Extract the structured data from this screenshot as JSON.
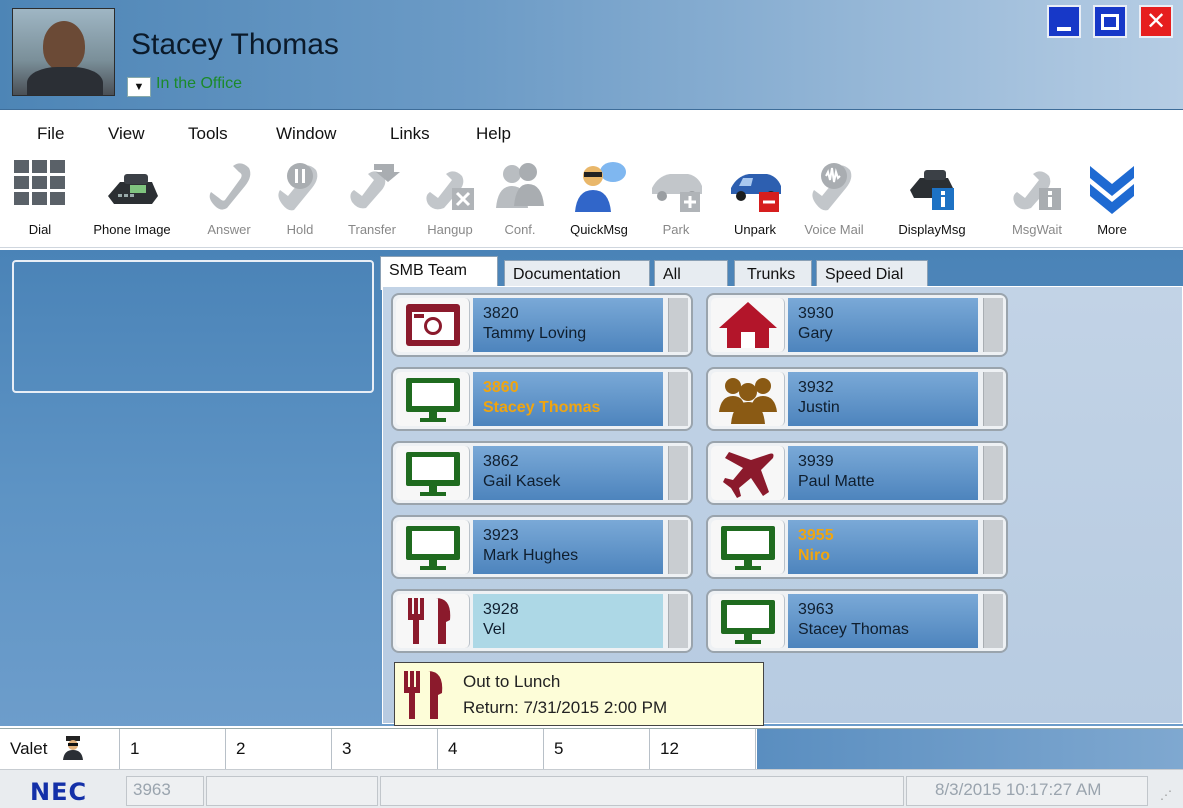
{
  "window": {
    "user_name": "Stacey Thomas",
    "presence": "In the Office",
    "controls": {
      "minimize": "minimize",
      "maximize": "maximize",
      "close": "✕"
    }
  },
  "menu": [
    "File",
    "View",
    "Tools",
    "Window",
    "Links",
    "Help"
  ],
  "toolbar": [
    {
      "label": "Dial",
      "icon": "dialpad-icon",
      "enabled": true
    },
    {
      "label": "Phone Image",
      "icon": "desk-phone-icon",
      "enabled": true
    },
    {
      "label": "Answer",
      "icon": "handset-icon",
      "enabled": false
    },
    {
      "label": "Hold",
      "icon": "hold-icon",
      "enabled": false
    },
    {
      "label": "Transfer",
      "icon": "transfer-icon",
      "enabled": false
    },
    {
      "label": "Hangup",
      "icon": "hangup-icon",
      "enabled": false
    },
    {
      "label": "Conf.",
      "icon": "conference-icon",
      "enabled": false
    },
    {
      "label": "QuickMsg",
      "icon": "quickmsg-icon",
      "enabled": true
    },
    {
      "label": "Park",
      "icon": "park-icon",
      "enabled": false
    },
    {
      "label": "Unpark",
      "icon": "unpark-icon",
      "enabled": true
    },
    {
      "label": "Voice Mail",
      "icon": "voicemail-icon",
      "enabled": false
    },
    {
      "label": "DisplayMsg",
      "icon": "displaymsg-icon",
      "enabled": true
    },
    {
      "label": "MsgWait",
      "icon": "msgwait-icon",
      "enabled": false
    },
    {
      "label": "More",
      "icon": "more-chevron-icon",
      "enabled": true
    }
  ],
  "tabs": [
    "SMB Team",
    "Documentation",
    "All",
    "Trunks",
    "Speed Dial"
  ],
  "active_tab": "SMB Team",
  "contacts": [
    {
      "ext": "3820",
      "name": "Tammy Loving",
      "status_icon": "camera-icon",
      "busy": false,
      "highlight": false
    },
    {
      "ext": "3930",
      "name": "Gary",
      "status_icon": "home-icon",
      "busy": false,
      "highlight": false
    },
    {
      "ext": "3860",
      "name": "Stacey Thomas",
      "status_icon": "monitor-icon",
      "busy": true,
      "highlight": false
    },
    {
      "ext": "3932",
      "name": "Justin",
      "status_icon": "meeting-icon",
      "busy": false,
      "highlight": false
    },
    {
      "ext": "3862",
      "name": "Gail Kasek",
      "status_icon": "monitor-icon",
      "busy": false,
      "highlight": false
    },
    {
      "ext": "3939",
      "name": "Paul Matte",
      "status_icon": "airplane-icon",
      "busy": false,
      "highlight": false
    },
    {
      "ext": "3923",
      "name": "Mark Hughes",
      "status_icon": "monitor-icon",
      "busy": false,
      "highlight": false
    },
    {
      "ext": "3955",
      "name": "Niro",
      "status_icon": "monitor-icon",
      "busy": true,
      "highlight": false
    },
    {
      "ext": "3928",
      "name": "Vel",
      "status_icon": "lunch-icon",
      "busy": false,
      "highlight": true
    },
    {
      "ext": "3963",
      "name": "Stacey Thomas",
      "status_icon": "monitor-icon",
      "busy": false,
      "highlight": false
    }
  ],
  "tooltip": {
    "line1": "Out to Lunch",
    "line2": "Return: 7/31/2015 2:00 PM"
  },
  "valet": {
    "label": "Valet",
    "slots": [
      "1",
      "2",
      "3",
      "4",
      "5",
      "12"
    ]
  },
  "statusbar": {
    "brand": "NEC",
    "extension": "3963",
    "datetime": "8/3/2015 10:17:27 AM"
  },
  "colors": {
    "busy_text": "#f0a510",
    "presence_green": "#1b8a2a",
    "status_icon_red": "#8b1a2c",
    "status_icon_green": "#1f6b1f",
    "status_icon_brown": "#8a5a14"
  }
}
